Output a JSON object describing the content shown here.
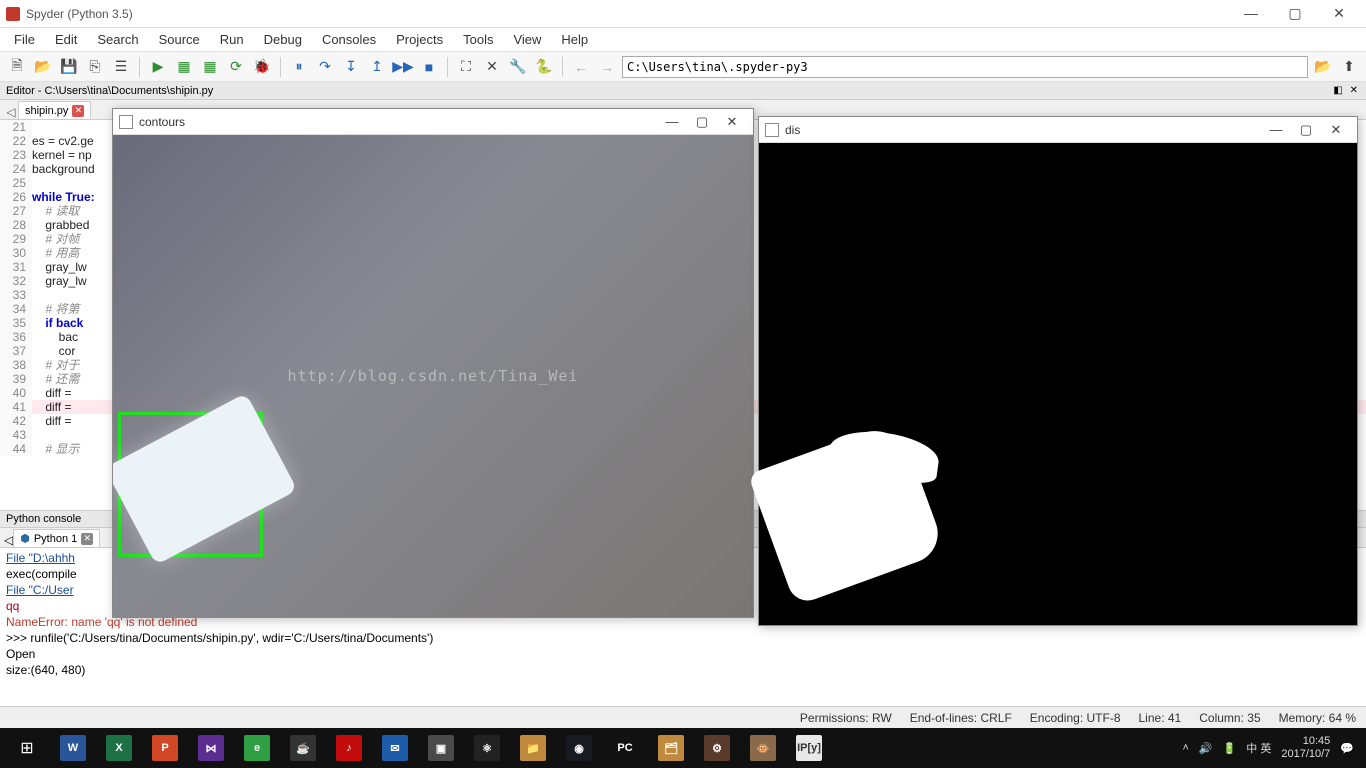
{
  "titlebar": {
    "title": "Spyder (Python 3.5)"
  },
  "menu": {
    "file": "File",
    "edit": "Edit",
    "search": "Search",
    "source": "Source",
    "run": "Run",
    "debug": "Debug",
    "consoles": "Consoles",
    "projects": "Projects",
    "tools": "Tools",
    "view": "View",
    "help": "Help"
  },
  "toolbar": {
    "path": "C:\\Users\\tina\\.spyder-py3"
  },
  "editor": {
    "title": "Editor - C:\\Users\\tina\\Documents\\shipin.py",
    "tab": "shipin.py",
    "lines": [
      {
        "n": 21,
        "t": ""
      },
      {
        "n": 22,
        "t": "es = cv2.ge"
      },
      {
        "n": 23,
        "t": "kernel = np"
      },
      {
        "n": 24,
        "t": "background "
      },
      {
        "n": 25,
        "t": ""
      },
      {
        "n": 26,
        "t": "while True:",
        "kw": true
      },
      {
        "n": 27,
        "t": "    # 读取",
        "cm": true
      },
      {
        "n": 28,
        "t": "    grabbed"
      },
      {
        "n": 29,
        "t": "    # 对帧",
        "cm": true
      },
      {
        "n": 30,
        "t": "    # 用高",
        "cm": true
      },
      {
        "n": 31,
        "t": "    gray_lw"
      },
      {
        "n": 32,
        "t": "    gray_lw"
      },
      {
        "n": 33,
        "t": ""
      },
      {
        "n": 34,
        "t": "    # 将第",
        "cm": true
      },
      {
        "n": 35,
        "t": "    if back",
        "kw": true
      },
      {
        "n": 36,
        "t": "        bac"
      },
      {
        "n": 37,
        "t": "        cor"
      },
      {
        "n": 38,
        "t": "    # 对于",
        "cm": true
      },
      {
        "n": 39,
        "t": "    # 还需",
        "cm": true
      },
      {
        "n": 40,
        "t": "    diff ="
      },
      {
        "n": 41,
        "t": "    diff =",
        "hl": true
      },
      {
        "n": 42,
        "t": "    diff ="
      },
      {
        "n": 43,
        "t": ""
      },
      {
        "n": 44,
        "t": "    # 显示",
        "cm": true
      }
    ]
  },
  "console": {
    "title": "Python console",
    "tab": "Python 1",
    "lines": [
      {
        "cls": "link",
        "t": "File \"D:\\ahhh"
      },
      {
        "cls": "",
        "t": "    exec(compile"
      },
      {
        "cls": "link",
        "t": "File \"C:/User"
      },
      {
        "cls": "err",
        "t": "    qq"
      },
      {
        "cls": "err2",
        "t": "NameError: name 'qq' is not defined"
      },
      {
        "cls": "",
        "t": ">>> runfile('C:/Users/tina/Documents/shipin.py', wdir='C:/Users/tina/Documents')"
      },
      {
        "cls": "",
        "t": "Open"
      },
      {
        "cls": "",
        "t": "size:(640, 480)"
      }
    ]
  },
  "status": {
    "perm_label": "Permissions:",
    "perm": "RW",
    "eol_label": "End-of-lines:",
    "eol": "CRLF",
    "enc_label": "Encoding:",
    "enc": "UTF-8",
    "line_label": "Line:",
    "line": "41",
    "col_label": "Column:",
    "col": "35",
    "mem_label": "Memory:",
    "mem": "64 %"
  },
  "popups": {
    "contours": {
      "title": "contours",
      "watermark": "http://blog.csdn.net/Tina_Wei"
    },
    "dis": {
      "title": "dis"
    }
  },
  "tray": {
    "ime": "英",
    "time": "10:45",
    "date": "2017/10/7"
  }
}
